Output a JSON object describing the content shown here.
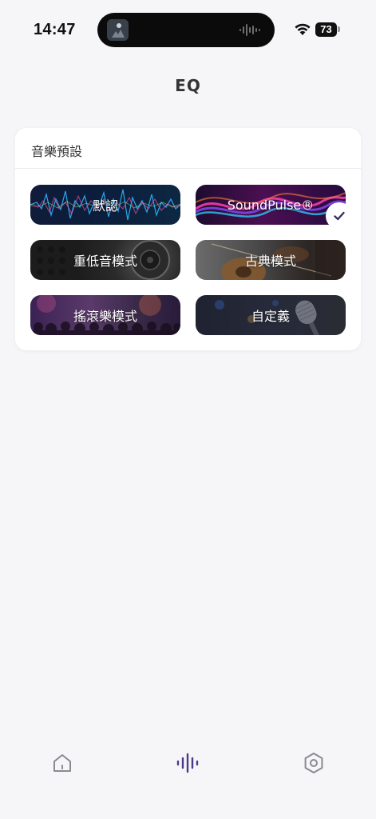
{
  "status_bar": {
    "time": "14:47",
    "battery": "73"
  },
  "header": {
    "title": "EQ"
  },
  "presets": {
    "section_title": "音樂預設",
    "items": [
      {
        "label": "默認",
        "selected": false
      },
      {
        "label": "SoundPulse®",
        "selected": true
      },
      {
        "label": "重低音模式",
        "selected": false
      },
      {
        "label": "古典模式",
        "selected": false
      },
      {
        "label": "搖滾樂模式",
        "selected": false
      },
      {
        "label": "自定義",
        "selected": false
      }
    ]
  },
  "tab_bar": {
    "items": [
      {
        "icon": "home-icon",
        "active": false
      },
      {
        "icon": "equalizer-icon",
        "active": true
      },
      {
        "icon": "settings-icon",
        "active": false
      }
    ]
  },
  "colors": {
    "accent": "#4a3a8c",
    "inactive_icon": "#8a8a90",
    "background": "#f6f5f7"
  }
}
